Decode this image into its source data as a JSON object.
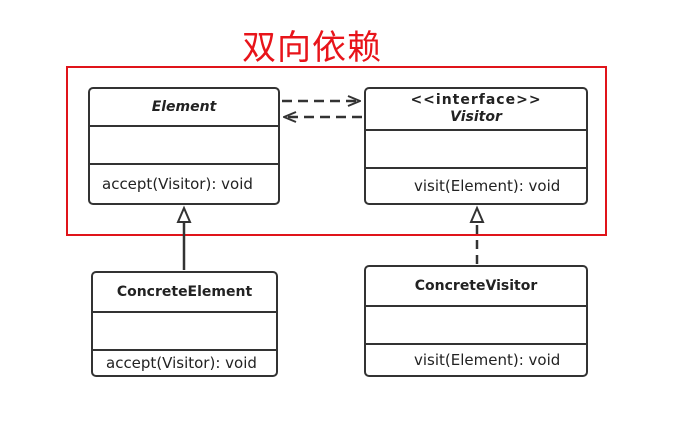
{
  "title": "双向依赖",
  "classes": {
    "element": {
      "name": "Element",
      "operation": "accept(Visitor): void"
    },
    "visitor": {
      "stereotype": "<<interface>>",
      "name": "Visitor",
      "operation": "visit(Element): void"
    },
    "concrete_element": {
      "name": "ConcreteElement",
      "operation": "accept(Visitor): void"
    },
    "concrete_visitor": {
      "name": "ConcreteVisitor",
      "operation": "visit(Element): void"
    }
  },
  "colors": {
    "title": "#e8141a",
    "frame": "#e0141a",
    "lines": "#333333"
  }
}
